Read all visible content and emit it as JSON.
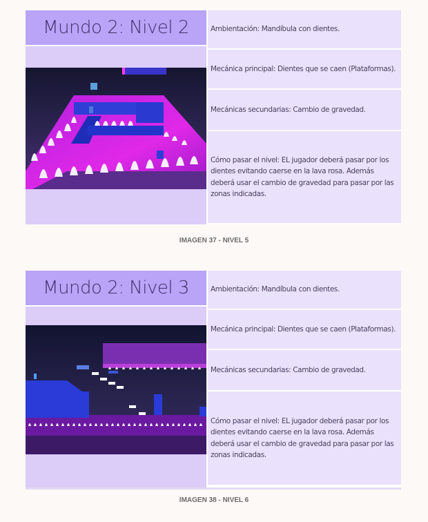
{
  "sections": [
    {
      "title": "Mundo 2: Nivel 2",
      "rows": [
        "Ambientación: Mandíbula con dientes.",
        "Mecánica principal: Dientes que se caen (Plataformas).",
        "Mecánicas secundarias: Cambio de gravedad.",
        "Cómo pasar el nivel: EL jugador deberá pasar por los dientes evitando caerse en la lava rosa. Además deberá usar el cambio de gravedad para pasar por las zonas indicadas."
      ],
      "caption": "IMAGEN 37 - NIVEL 5"
    },
    {
      "title": "Mundo 2: Nivel 3",
      "rows": [
        "Ambientación: Mandíbula con dientes.",
        "Mecánica principal: Dientes que se caen (Plataformas).",
        "Mecánicas secundarias: Cambio de gravedad.",
        "Cómo pasar el nivel: EL jugador deberá pasar por los dientes evitando caerse en la lava rosa. Además deberá usar el cambio de gravedad para pasar por las zonas indicadas."
      ],
      "caption": "IMAGEN 38 - NIVEL 6"
    }
  ]
}
